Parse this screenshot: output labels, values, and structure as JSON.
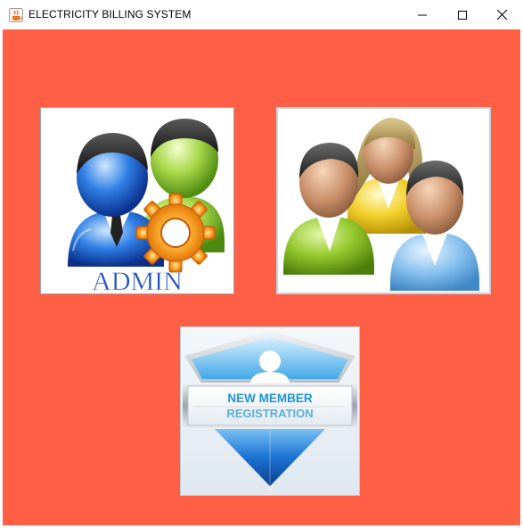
{
  "window": {
    "title": "ELECTRICITY BILLING SYSTEM",
    "icons": [
      "java-cup-icon",
      "minimize-icon",
      "maximize-icon",
      "close-icon"
    ],
    "background_color": "#ff5f45"
  },
  "tiles": {
    "admin": {
      "label": "ADMIN",
      "label_color": "#1c4fc4",
      "icon": "admin-users-gear-icon"
    },
    "customers": {
      "icon": "customers-group-icon"
    },
    "registration": {
      "line1": "NEW MEMBER",
      "line2": "REGISTRATION",
      "text_color": "#1b95d6",
      "icon": "new-member-registration-badge-icon"
    }
  }
}
